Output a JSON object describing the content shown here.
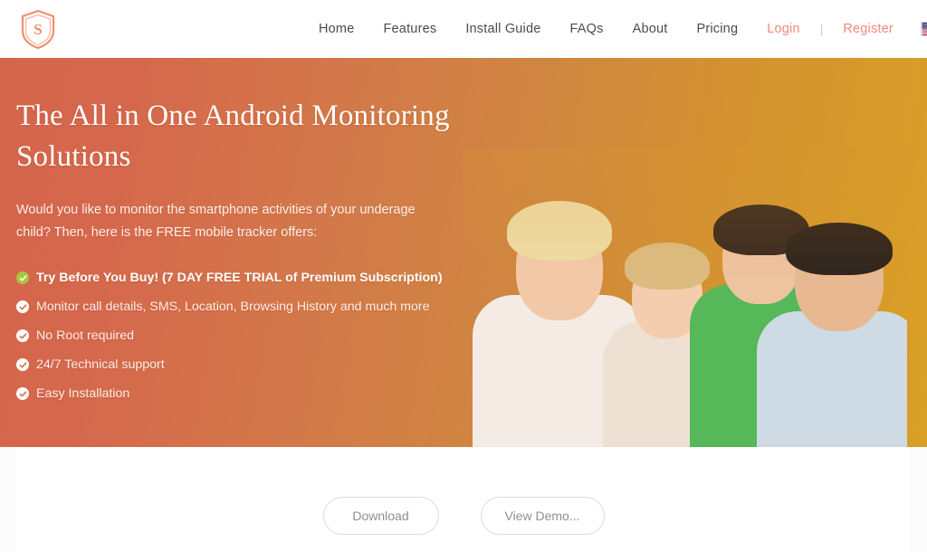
{
  "nav": {
    "logo_alt": "Shield S logo",
    "links": [
      {
        "label": "Home",
        "accent": false
      },
      {
        "label": "Features",
        "accent": false
      },
      {
        "label": "Install Guide",
        "accent": false
      },
      {
        "label": "FAQs",
        "accent": false
      },
      {
        "label": "About",
        "accent": false
      },
      {
        "label": "Pricing",
        "accent": false
      },
      {
        "label": "Login",
        "accent": true
      },
      {
        "label": "Register",
        "accent": true
      }
    ],
    "separator": "|",
    "language": "United States"
  },
  "hero": {
    "title": "The All in One Android Monitoring Solutions",
    "subtitle": "Would you like to monitor the smartphone activities of your underage child? Then, here is the FREE mobile tracker offers:",
    "features": [
      {
        "text": "Try Before You Buy! (7 DAY FREE TRIAL of Premium Subscription)",
        "bold": true,
        "highlight": true
      },
      {
        "text": "Monitor call details, SMS, Location, Browsing History and much more",
        "bold": false,
        "highlight": false
      },
      {
        "text": "No Root required",
        "bold": false,
        "highlight": false
      },
      {
        "text": "24/7 Technical support",
        "bold": false,
        "highlight": false
      },
      {
        "text": "Easy Installation",
        "bold": false,
        "highlight": false
      }
    ],
    "image_alt": "Smiling family of four - mother, daughter, son and father"
  },
  "actions": {
    "download_label": "Download",
    "demo_label": "View Demo..."
  },
  "colors": {
    "accent": "#f08a7a",
    "hero_gradient_start": "#d5654b",
    "hero_gradient_end": "#d8a026",
    "nav_text": "#4a4a55",
    "button_border": "#dcdce2",
    "button_text": "#8e8e99",
    "highlight_tick": "#a9c73c"
  }
}
